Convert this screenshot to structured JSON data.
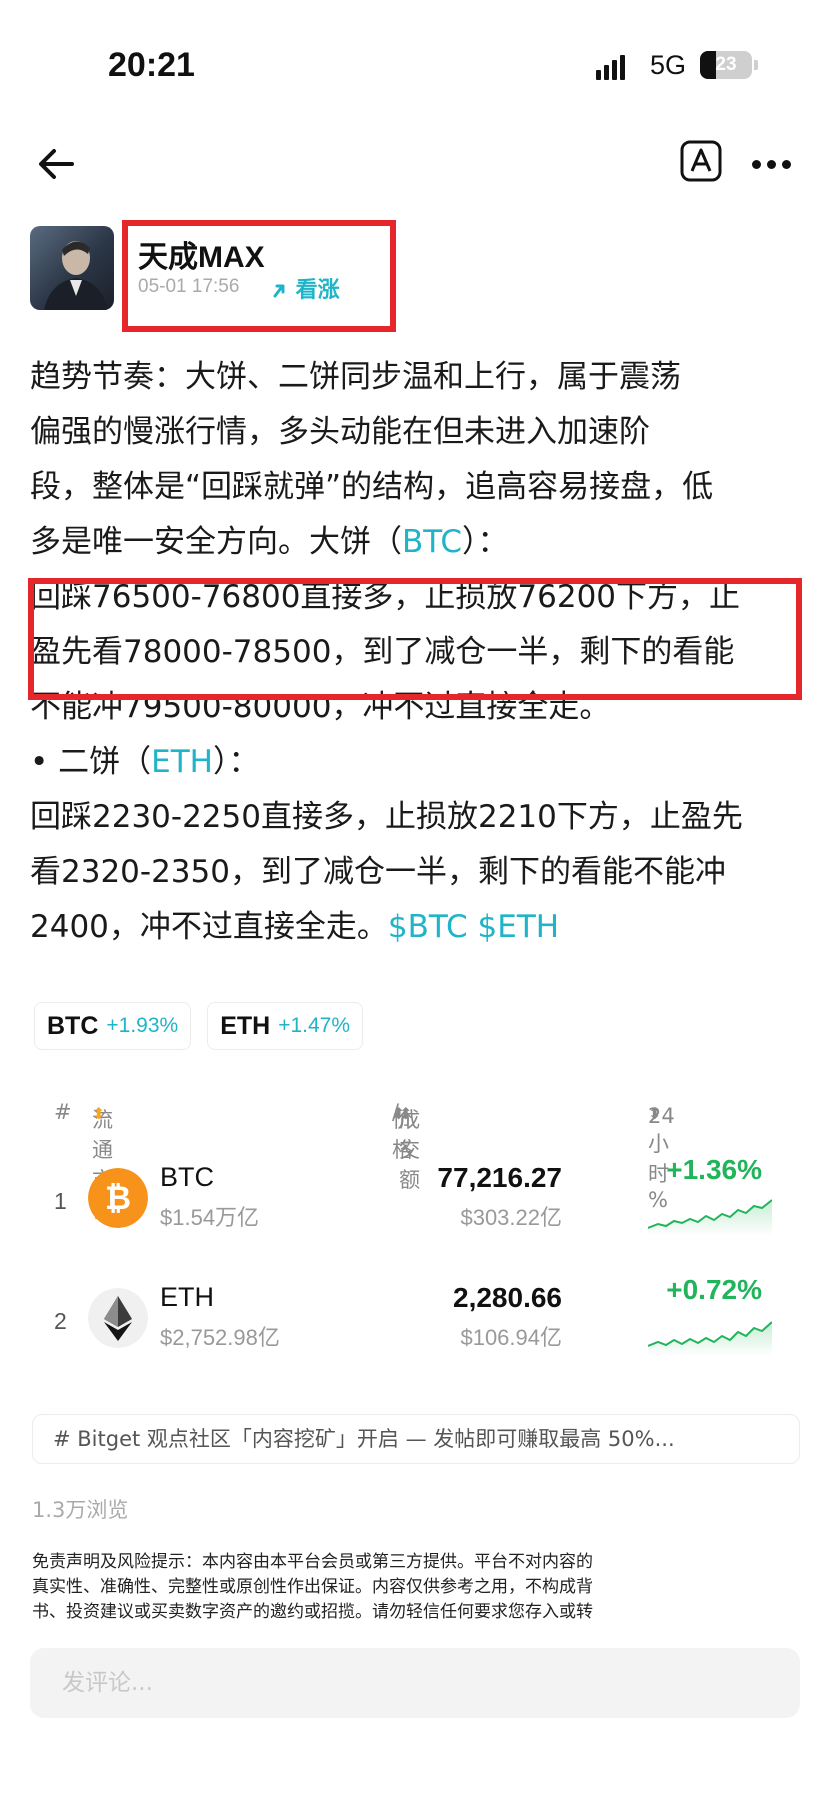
{
  "status_bar": {
    "time": "20:21",
    "network": "5G",
    "battery": "23"
  },
  "post": {
    "author": "天成MAX",
    "timestamp": "05-01 17:56",
    "sentiment": "看涨",
    "body_lines": [
      {
        "text": "趋势节奏：大饼、二饼同步温和上行，属于震荡"
      },
      {
        "text": "偏强的慢涨行情，多头动能在但未进入加速阶"
      },
      {
        "text": "段，整体是“回踩就弹”的结构，追高容易接盘，低"
      },
      {
        "pre": "多是唯一安全方向。大饼（",
        "link": "BTC",
        "post": "）："
      },
      {
        "text": "回踩76500-76800直接多，止损放76200下方，止"
      },
      {
        "text": "盈先看78000-78500，到了减仓一半，剩下的看能"
      },
      {
        "text": "不能冲79500-80000，冲不过直接全走。"
      },
      {
        "pre": "• 二饼（",
        "link": "ETH",
        "post": "）："
      },
      {
        "text": "回踩2230-2250直接多，止损放2210下方，止盈先"
      },
      {
        "text": "看2320-2350，到了减仓一半，剩下的看能不能冲"
      },
      {
        "pre": "2400，冲不过直接全走。",
        "link": "$BTC $ETH",
        "post": ""
      }
    ]
  },
  "tags": [
    {
      "symbol": "BTC",
      "change": "+1.93%"
    },
    {
      "symbol": "ETH",
      "change": "+1.47%"
    }
  ],
  "market": {
    "headers": {
      "rank": "#",
      "cap": "流通市值",
      "price": "价格",
      "volume": "成交额",
      "change": "24小时 %"
    },
    "rows": [
      {
        "rank": "1",
        "symbol": "BTC",
        "market_cap": "$1.54万亿",
        "price": "77,216.27",
        "volume": "$303.22亿",
        "change": "+1.36%"
      },
      {
        "rank": "2",
        "symbol": "ETH",
        "market_cap": "$2,752.98亿",
        "price": "2,280.66",
        "volume": "$106.94亿",
        "change": "+0.72%"
      }
    ]
  },
  "topic": "# Bitget 观点社区「内容挖矿」开启 — 发帖即可赚取最高 50%...",
  "views": "1.3万浏览",
  "disclaimer_lines": [
    "免责声明及风险提示：本内容由本平台会员或第三方提供。平台不对内容的",
    "真实性、准确性、完整性或原创性作出保证。内容仅供参考之用，不构成背",
    "书、投资建议或买卖数字资产的邀约或招揽。请勿轻信任何要求您存入或转"
  ],
  "comment_placeholder": "发评论...",
  "colors": {
    "accent": "#1fb4c8",
    "up": "#22b45a",
    "highlight_border": "#e5262b",
    "btc": "#f7931a"
  }
}
